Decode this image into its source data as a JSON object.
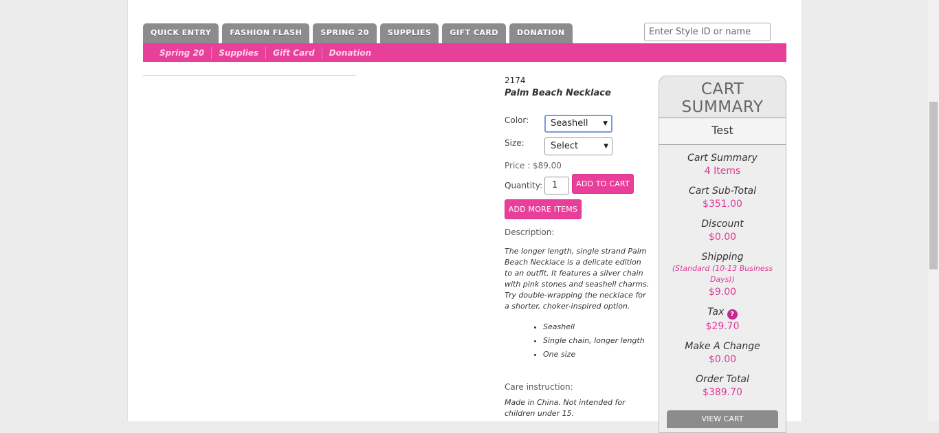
{
  "tabs": [
    "QUICK ENTRY",
    "FASHION FLASH",
    "SPRING 20",
    "SUPPLIES",
    "GIFT CARD",
    "DONATION"
  ],
  "search": {
    "placeholder": "Enter Style ID or name"
  },
  "subnav": [
    "Spring 20",
    "Supplies",
    "Gift Card",
    "Donation"
  ],
  "product": {
    "style_id": "2174",
    "name": "Palm Beach Necklace",
    "color_label": "Color:",
    "color_value": "Seashell",
    "size_label": "Size:",
    "size_value": "Select",
    "price": "Price : $89.00",
    "quantity_label": "Quantity:",
    "quantity_value": "1",
    "add_to_cart": "ADD TO CART",
    "add_more": "ADD MORE ITEMS",
    "description_label": "Description:",
    "description": "The longer length, single strand Palm Beach Necklace is a delicate edition to an outfit. It features a silver chain with pink stones and seashell charms. Try double-wrapping the necklace for a shorter, choker-inspired option.",
    "bullets": [
      "Seashell",
      "Single chain, longer length",
      "One size"
    ],
    "care_label": "Care instruction:",
    "care": "Made in China. Not intended for children under 15."
  },
  "cart": {
    "title": "CART SUMMARY",
    "user": "Test",
    "summary_label": "Cart Summary",
    "items": "4 Items",
    "subtotal_label": "Cart Sub-Total",
    "subtotal": "$351.00",
    "discount_label": "Discount",
    "discount": "$0.00",
    "shipping_label": "Shipping",
    "shipping_note": "(Standard (10-13 Business Days))",
    "shipping": "$9.00",
    "tax_label": "Tax",
    "tax": "$29.70",
    "change_label": "Make A Change",
    "change": "$0.00",
    "total_label": "Order Total",
    "total": "$389.70",
    "view_cart": "VIEW CART"
  },
  "colors": {
    "accent": "#e8409a",
    "tab": "#8c8c8c"
  },
  "icons": {
    "tax_help": "question-circle-icon",
    "select_arrow": "caret-down-icon"
  }
}
